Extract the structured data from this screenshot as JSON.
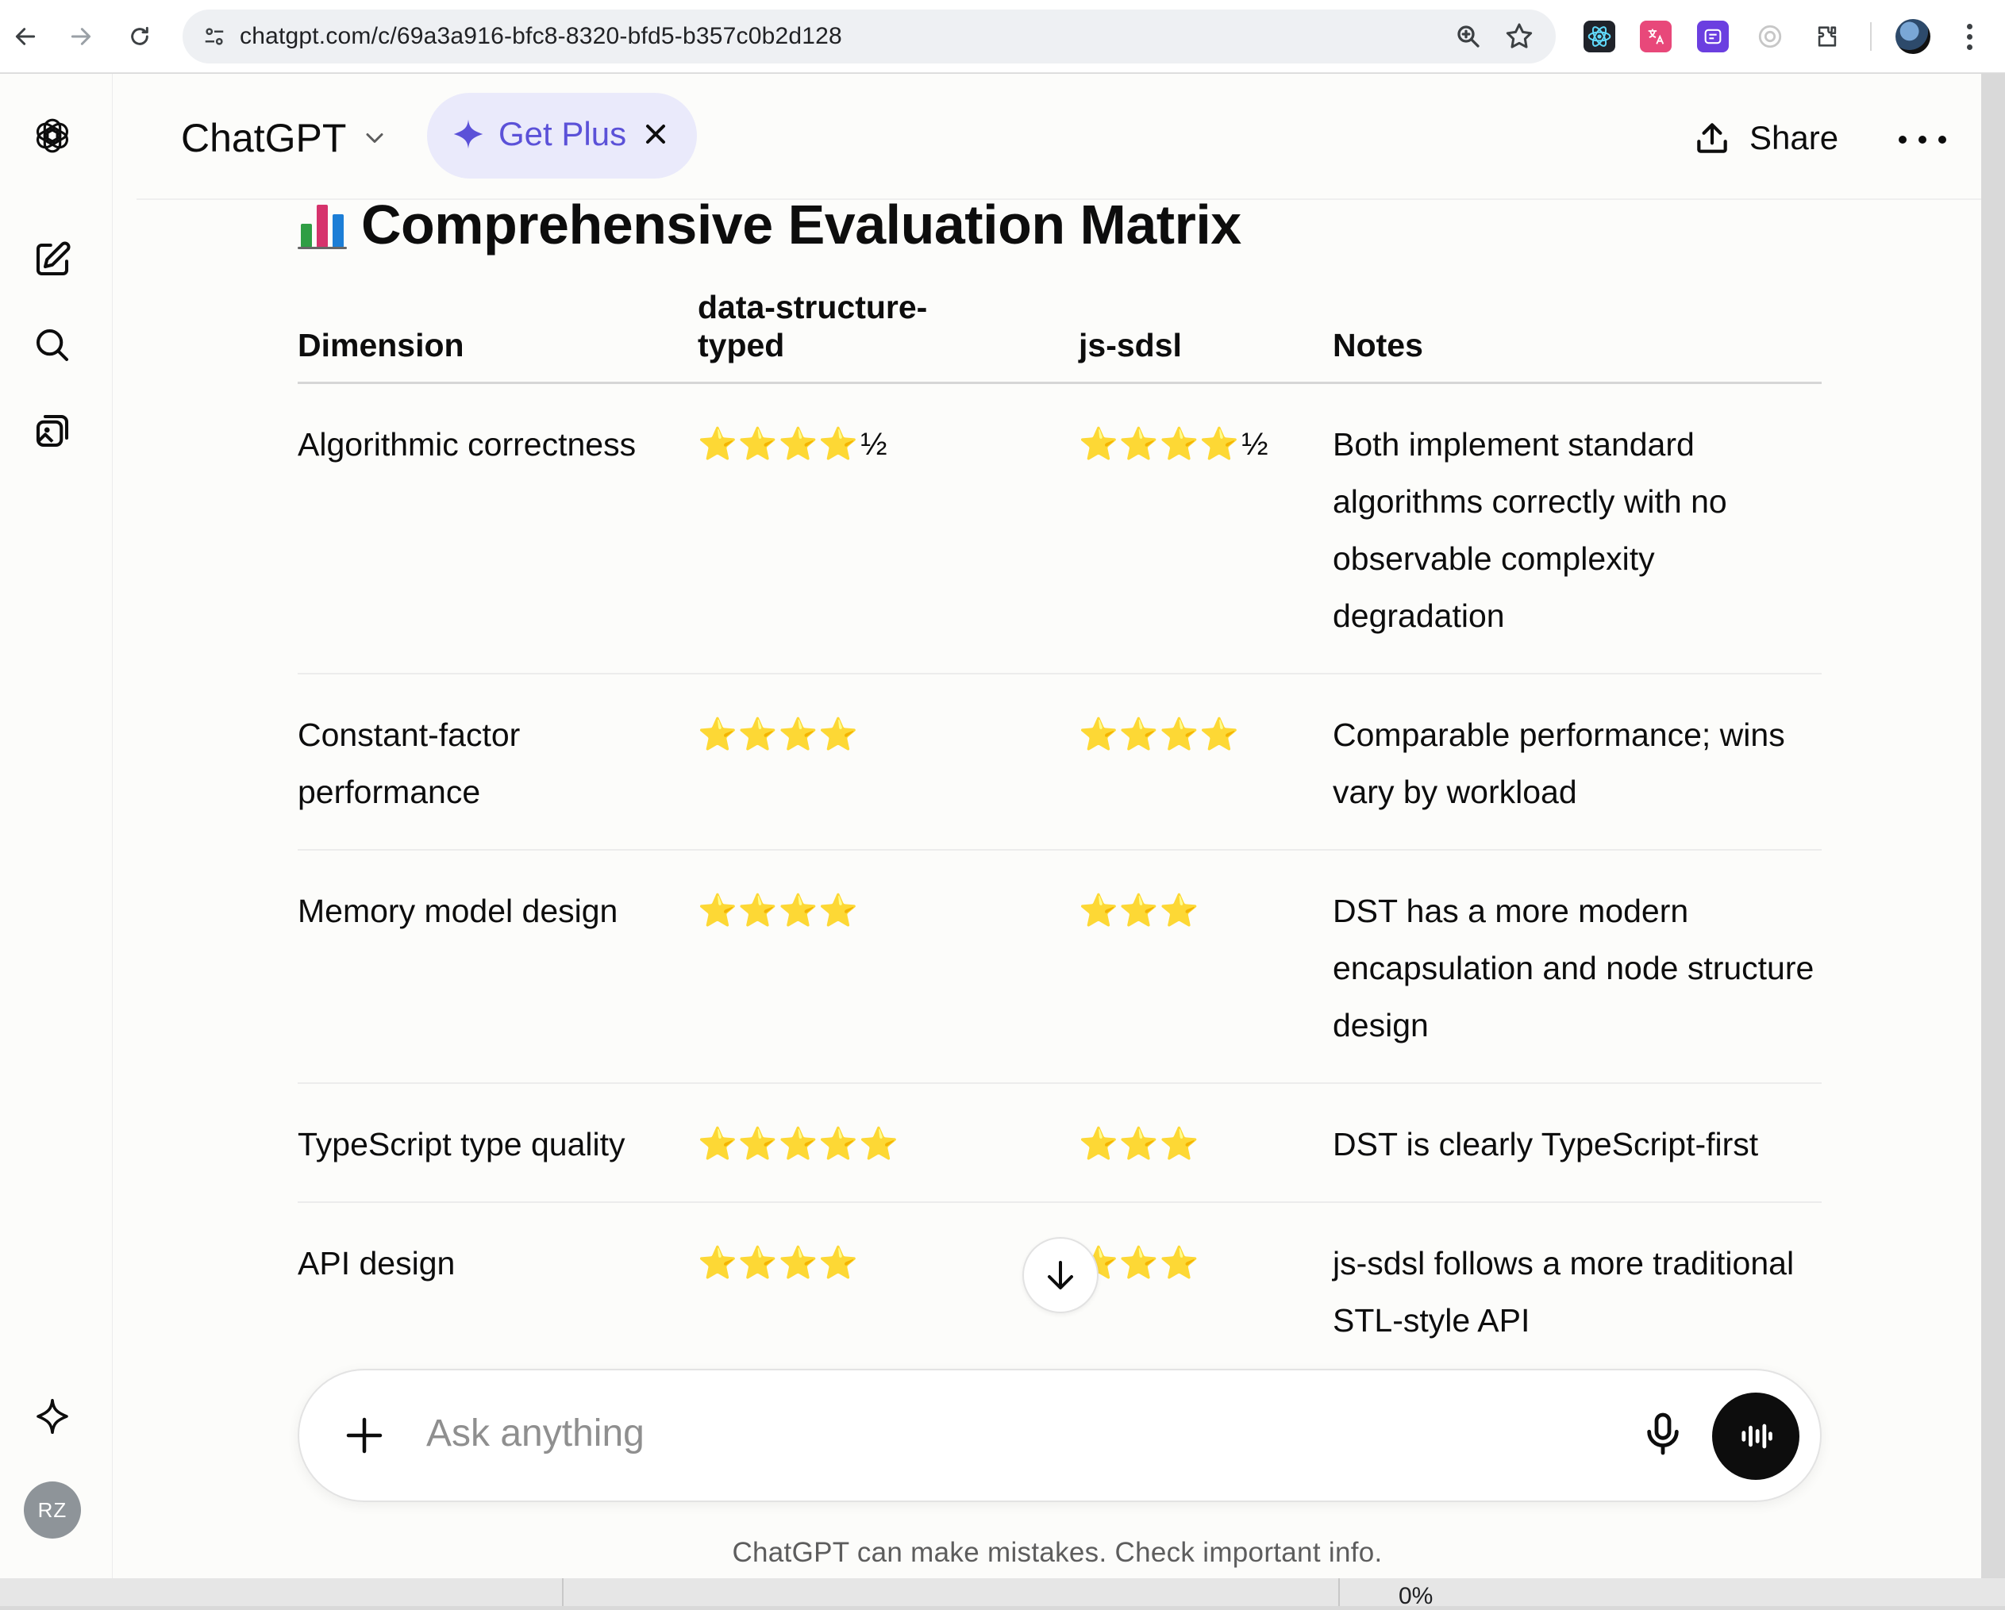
{
  "browser": {
    "url": "chatgpt.com/c/69a3a916-bfc8-8320-bfd5-b357c0b2d128"
  },
  "header": {
    "model_name": "ChatGPT",
    "get_plus_label": "Get Plus",
    "share_label": "Share"
  },
  "sidebar": {
    "avatar_initials": "RZ"
  },
  "section": {
    "title": "Comprehensive Evaluation Matrix"
  },
  "table": {
    "headers": {
      "dimension": "Dimension",
      "dst_line1": "data-structure-",
      "dst_line2": "typed",
      "jssdsl": "js-sdsl",
      "notes": "Notes"
    },
    "rows": [
      {
        "dimension": "Algorithmic correctness",
        "dst": "⭐⭐⭐⭐",
        "dst_half": "½",
        "jssdsl": "⭐⭐⭐⭐",
        "jssdsl_half": "½",
        "notes": "Both implement standard algorithms correctly with no observable complexity degradation"
      },
      {
        "dimension": "Constant-factor performance",
        "dst": "⭐⭐⭐⭐",
        "jssdsl": "⭐⭐⭐⭐",
        "notes": "Comparable performance; wins vary by workload"
      },
      {
        "dimension": "Memory model design",
        "dst": "⭐⭐⭐⭐",
        "jssdsl": "⭐⭐⭐",
        "notes": "DST has a more modern encapsulation and node structure design"
      },
      {
        "dimension": "TypeScript type quality",
        "dst": "⭐⭐⭐⭐⭐",
        "jssdsl": "⭐⭐⭐",
        "notes": "DST is clearly TypeScript-first"
      },
      {
        "dimension": "API design",
        "dst": "⭐⭐⭐⭐",
        "jssdsl": "⭐⭐⭐",
        "notes": "js-sdsl follows a more traditional STL-style API"
      }
    ]
  },
  "composer": {
    "placeholder": "Ask anything"
  },
  "footer": {
    "disclaimer": "ChatGPT can make mistakes. Check important info."
  },
  "background_window": {
    "percent_text": "0%"
  },
  "colors": {
    "accent_purple": "#5b51d8",
    "get_plus_bg": "#eaeafb",
    "star_gold": "#f5b301"
  }
}
